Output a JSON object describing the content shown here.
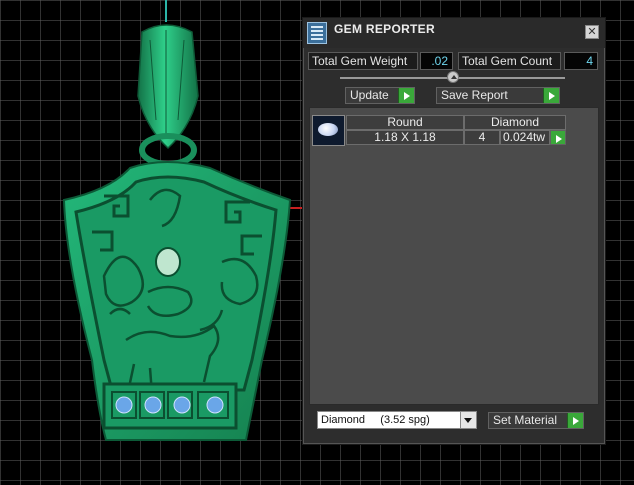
{
  "panel": {
    "title": "GEM REPORTER",
    "close_glyph": "✕",
    "total_gem_weight_label": "Total Gem Weight",
    "total_gem_weight_value": ".02",
    "total_gem_count_label": "Total Gem Count",
    "total_gem_count_value": "4",
    "update_label": "Update",
    "save_report_label": "Save Report",
    "gem_table": {
      "headers": [
        "Round",
        "Diamond"
      ],
      "rows": [
        {
          "size": "1.18 X 1.18",
          "count": "4",
          "weight": "0.024tw",
          "thumbnail_icon": "round-gem-icon"
        }
      ]
    },
    "material_select": {
      "selected": "Diamond     (3.52 spg)"
    },
    "set_material_label": "Set Material"
  },
  "colors": {
    "model_green": "#1fa06b",
    "accent_green_button": "#3aa83a",
    "value_text": "#6fd6ee",
    "gem_blue": "#6aa6e8",
    "axis_red": "#c82020"
  }
}
